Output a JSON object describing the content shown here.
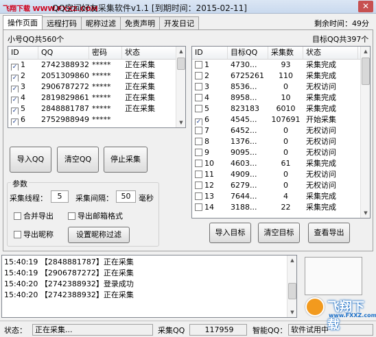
{
  "window": {
    "watermark": "飞翔下载 WWW.FXXZ.COM",
    "title": "QQ空间好友采集软件v1.1 [到期时间：2015-02-11]",
    "remaining_time": "剩余时间：49分"
  },
  "tabs": [
    "操作页面",
    "远程打码",
    "昵称过滤",
    "免责声明",
    "开发日记"
  ],
  "left_panel": {
    "count_label": "小号QQ共560个",
    "columns": [
      "ID",
      "QQ",
      "密码",
      "状态"
    ],
    "rows": [
      {
        "id": "1",
        "qq": "2742388932",
        "pwd": "*****",
        "status": "正在采集",
        "checked": true
      },
      {
        "id": "2",
        "qq": "2051309860",
        "pwd": "*****",
        "status": "正在采集",
        "checked": true
      },
      {
        "id": "3",
        "qq": "2906787272",
        "pwd": "*****",
        "status": "正在采集",
        "checked": true
      },
      {
        "id": "4",
        "qq": "2819829861",
        "pwd": "*****",
        "status": "正在采集",
        "checked": true
      },
      {
        "id": "5",
        "qq": "2848881787",
        "pwd": "*****",
        "status": "正在采集",
        "checked": true
      },
      {
        "id": "6",
        "qq": "2752988949",
        "pwd": "*****",
        "status": "",
        "checked": true
      }
    ],
    "buttons": {
      "import": "导入QQ",
      "clear": "清空QQ",
      "stop": "停止采集"
    }
  },
  "params": {
    "group_label": "参数",
    "threads_label": "采集线程：",
    "threads_value": "5",
    "interval_label": "采集间隔：",
    "interval_value": "50",
    "interval_unit": "毫秒",
    "merge_export": "合并导出",
    "export_mail": "导出邮箱格式",
    "export_nick": "导出昵称",
    "nick_filter_button": "设置昵称过滤"
  },
  "right_panel": {
    "count_label": "目标QQ共397个",
    "columns": [
      "ID",
      "目标QQ",
      "采集数",
      "状态"
    ],
    "rows": [
      {
        "id": "1",
        "qq": "4730...",
        "count": "93",
        "status": "采集完成",
        "checked": false
      },
      {
        "id": "2",
        "qq": "6725261",
        "count": "110",
        "status": "采集完成",
        "checked": false
      },
      {
        "id": "3",
        "qq": "8536...",
        "count": "0",
        "status": "无权访问",
        "checked": false
      },
      {
        "id": "4",
        "qq": "8958...",
        "count": "10",
        "status": "采集完成",
        "checked": false
      },
      {
        "id": "5",
        "qq": "823183",
        "count": "6010",
        "status": "采集完成",
        "checked": false
      },
      {
        "id": "6",
        "qq": "4545...",
        "count": "107691",
        "status": "开始采集",
        "checked": true
      },
      {
        "id": "7",
        "qq": "6452...",
        "count": "0",
        "status": "无权访问",
        "checked": false
      },
      {
        "id": "8",
        "qq": "1376...",
        "count": "0",
        "status": "无权访问",
        "checked": false
      },
      {
        "id": "9",
        "qq": "9095...",
        "count": "0",
        "status": "无权访问",
        "checked": false
      },
      {
        "id": "10",
        "qq": "4603...",
        "count": "61",
        "status": "采集完成",
        "checked": false
      },
      {
        "id": "11",
        "qq": "4909...",
        "count": "0",
        "status": "无权访问",
        "checked": false
      },
      {
        "id": "12",
        "qq": "6279...",
        "count": "0",
        "status": "无权访问",
        "checked": false
      },
      {
        "id": "13",
        "qq": "7644...",
        "count": "4",
        "status": "采集完成",
        "checked": false
      },
      {
        "id": "14",
        "qq": "3188...",
        "count": "22",
        "status": "采集完成",
        "checked": false
      }
    ],
    "buttons": {
      "import": "导入目标",
      "clear": "清空目标",
      "export": "查看导出"
    }
  },
  "log": [
    "15:40:19 【2848881787】正在采集",
    "15:40:19 【2906787272】正在采集",
    "15:40:20 【2742388932】登录成功",
    "15:40:20 【2742388932】正在采集"
  ],
  "statusbar": {
    "status_label": "状态：",
    "status_value": "正在采集...",
    "collect_label": "采集QQ",
    "collect_value": "117959",
    "version_label": "智能QQ：",
    "version_value": "软件试用中"
  },
  "logo": {
    "text": "飞翔下载",
    "url": "www.FXXZ.com"
  }
}
